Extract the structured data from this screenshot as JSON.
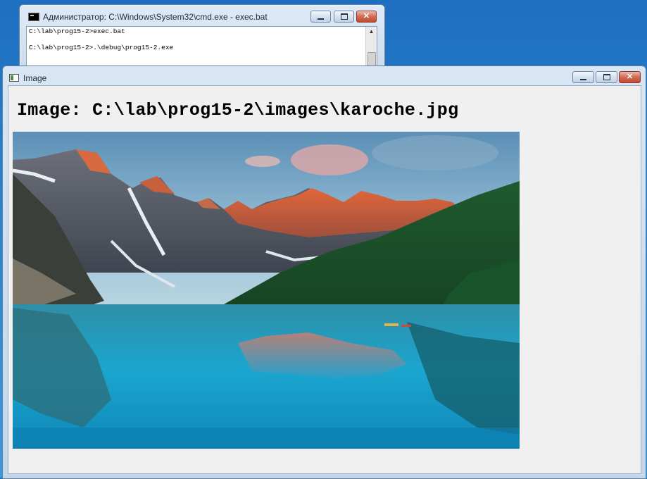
{
  "cmd_window": {
    "title": "Администратор: C:\\Windows\\System32\\cmd.exe - exec.bat",
    "lines": [
      "C:\\lab\\prog15-2>exec.bat",
      "C:\\lab\\prog15-2>.\\debug\\prog15-2.exe"
    ],
    "close_glyph": "✕",
    "scroll_up_glyph": "▲"
  },
  "image_window": {
    "title": "Image",
    "caption": "Image: C:\\lab\\prog15-2\\images\\karoche.jpg",
    "close_glyph": "✕"
  },
  "colors": {
    "desktop": "#2a86d4",
    "client_bg": "#f0f0f0",
    "close_button": "#c24a31"
  },
  "icons": {
    "cmd": "console-icon",
    "image": "window-icon",
    "photo": "mountain-lake-photo"
  }
}
